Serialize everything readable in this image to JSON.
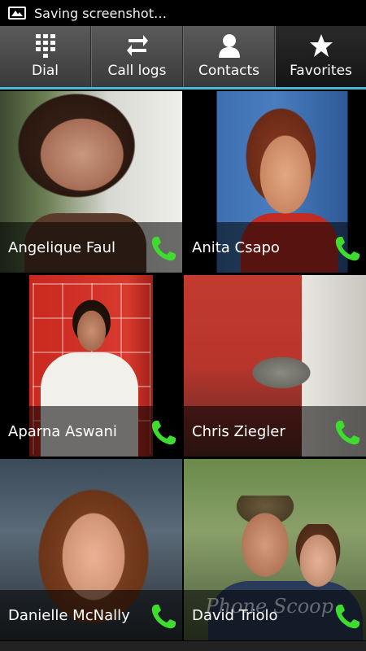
{
  "status_bar": {
    "text": "Saving screenshot…",
    "icon": "image-icon"
  },
  "tabs": [
    {
      "label": "Dial",
      "icon": "dialpad-icon",
      "active": false
    },
    {
      "label": "Call logs",
      "icon": "call-logs-icon",
      "active": false
    },
    {
      "label": "Contacts",
      "icon": "person-icon",
      "active": false
    },
    {
      "label": "Favorites",
      "icon": "star-icon",
      "active": true
    }
  ],
  "favorites": [
    {
      "name": "Angelique Faul"
    },
    {
      "name": "Anita Csapo"
    },
    {
      "name": "Aparna Aswani"
    },
    {
      "name": "Chris Ziegler"
    },
    {
      "name": "Danielle McNally"
    },
    {
      "name": "David Triolo"
    }
  ],
  "watermark": "Phone Scoop",
  "colors": {
    "accent": "#4ab8d8",
    "call_green": "#3ddc2e"
  }
}
